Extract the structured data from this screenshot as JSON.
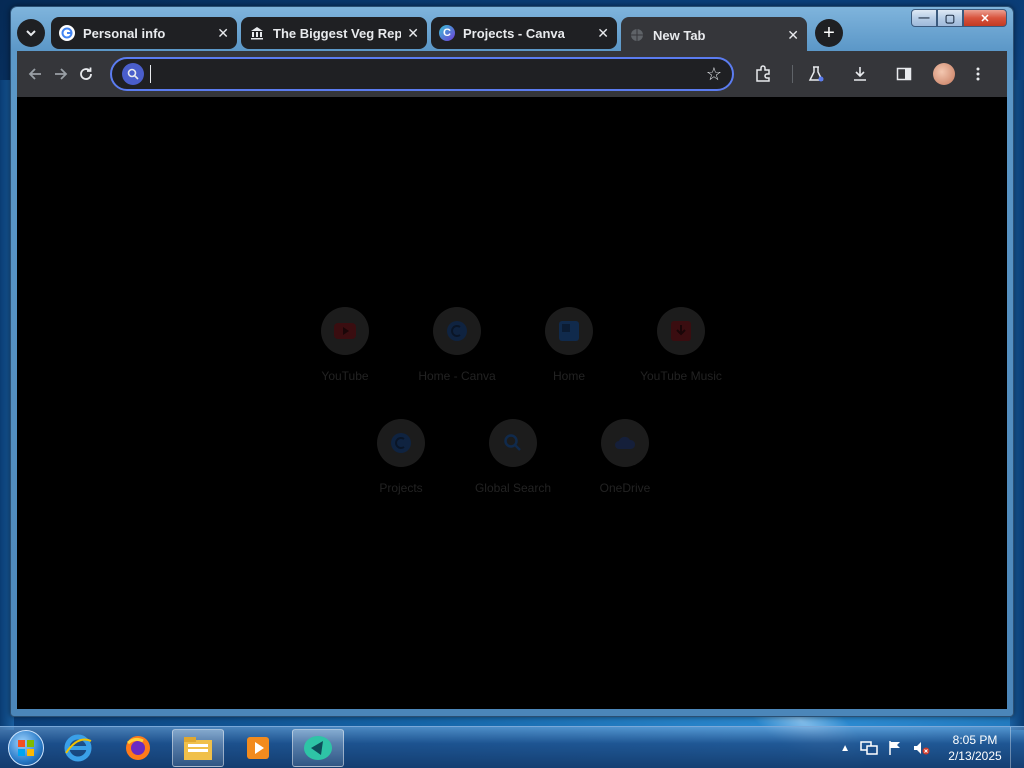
{
  "browser": {
    "tabs": [
      {
        "title": "Personal info",
        "favicon": "google-icon",
        "active": false
      },
      {
        "title": "The Biggest Veg Replac",
        "favicon": "museum-icon",
        "active": false
      },
      {
        "title": "Projects - Canva",
        "favicon": "canva-icon",
        "active": false
      },
      {
        "title": "New Tab",
        "favicon": "globe-icon",
        "active": true
      }
    ],
    "omnibox": {
      "value": "",
      "placeholder": ""
    },
    "window_controls": {
      "minimize": "—",
      "maximize": "▢",
      "close": "✕"
    }
  },
  "shortcuts": [
    {
      "name": "YouTube",
      "icon": "youtube-icon",
      "color": "#3a0d10"
    },
    {
      "name": "Home - Canva",
      "icon": "canva-icon",
      "color": "#0f2340"
    },
    {
      "name": "Home",
      "icon": "home-app-icon",
      "color": "#102a4c"
    },
    {
      "name": "YouTube Music",
      "icon": "download-icon",
      "color": "#3a0d10"
    },
    {
      "name": "Projects",
      "icon": "canva-icon",
      "color": "#0f2340"
    },
    {
      "name": "Global Search",
      "icon": "search-icon",
      "color": "#102a4c"
    },
    {
      "name": "OneDrive",
      "icon": "cloud-icon",
      "color": "#151f3a"
    }
  ],
  "taskbar": {
    "apps": [
      "internet-explorer-icon",
      "firefox-icon",
      "file-explorer-icon",
      "media-player-icon",
      "app-icon"
    ],
    "active_app": "app-icon"
  },
  "clock": {
    "time": "8:05 PM",
    "date": "2/13/2025"
  }
}
